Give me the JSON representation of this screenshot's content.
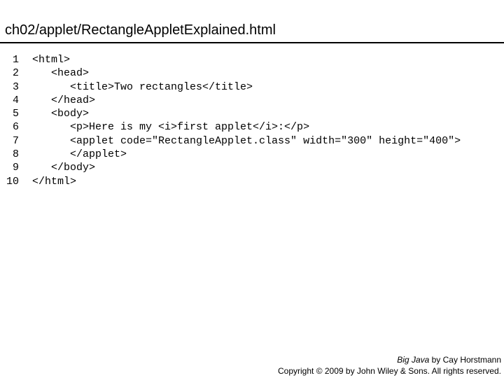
{
  "slide": {
    "title": "ch02/applet/RectangleAppletExplained.html"
  },
  "code": {
    "lines": [
      {
        "number": "1",
        "text": "<html>"
      },
      {
        "number": "2",
        "text": "   <head>"
      },
      {
        "number": "3",
        "text": "      <title>Two rectangles</title>"
      },
      {
        "number": "4",
        "text": "   </head>"
      },
      {
        "number": "5",
        "text": "   <body>"
      },
      {
        "number": "6",
        "text": "      <p>Here is my <i>first applet</i>:</p>"
      },
      {
        "number": "7",
        "text": "      <applet code=\"RectangleApplet.class\" width=\"300\" height=\"400\">"
      },
      {
        "number": "8",
        "text": "      </applet>"
      },
      {
        "number": "9",
        "text": "   </body>"
      },
      {
        "number": "10",
        "text": "</html>"
      }
    ]
  },
  "footer": {
    "book_title": "Big Java",
    "author_text": " by Cay Horstmann",
    "copyright": "Copyright © 2009 by John Wiley & Sons.  All rights reserved."
  }
}
